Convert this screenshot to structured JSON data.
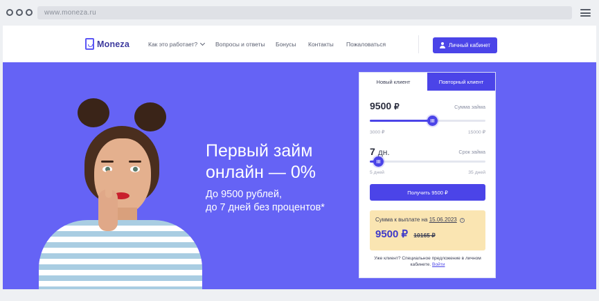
{
  "browser": {
    "url": "www.moneza.ru"
  },
  "header": {
    "logo_text": "Moneza",
    "menu": [
      {
        "label": "Как это работает?"
      },
      {
        "label": "Вопросы и ответы"
      },
      {
        "label": "Бонусы"
      },
      {
        "label": "Контакты"
      },
      {
        "label": "Пожаловаться"
      }
    ],
    "cabinet_label": "Личный кабинет"
  },
  "hero": {
    "title_line1": "Первый займ",
    "title_line2": "онлайн — 0%",
    "sub_line1": "До 9500 рублей,",
    "sub_line2": "до 7 дней без процентов*",
    "bg_color": "#6563f5"
  },
  "calculator": {
    "tabs": {
      "new_client": "Новый клиент",
      "repeat_client": "Повторный клиент"
    },
    "amount": {
      "value": "9500",
      "currency": "₽",
      "label": "Сумма займа",
      "min": "3000 ₽",
      "max": "15000 ₽",
      "slider_fraction": 0.54
    },
    "term": {
      "value": "7",
      "unit": "дн.",
      "label": "Срок займа",
      "min": "5 дней",
      "max": "35 дней",
      "slider_fraction": 0.07
    },
    "submit_label": "Получить 9500 ₽",
    "payout": {
      "label": "Сумма к выплате на",
      "date": "15.06.2023",
      "sum": "9500 ₽",
      "old_sum": "10165 ₽"
    },
    "existing_text": "Уже клиент? Специальное предложение в личном кабинете.",
    "login_link": "Войти"
  },
  "colors": {
    "accent": "#4b44e8",
    "payout_bg": "#fae5b2"
  }
}
